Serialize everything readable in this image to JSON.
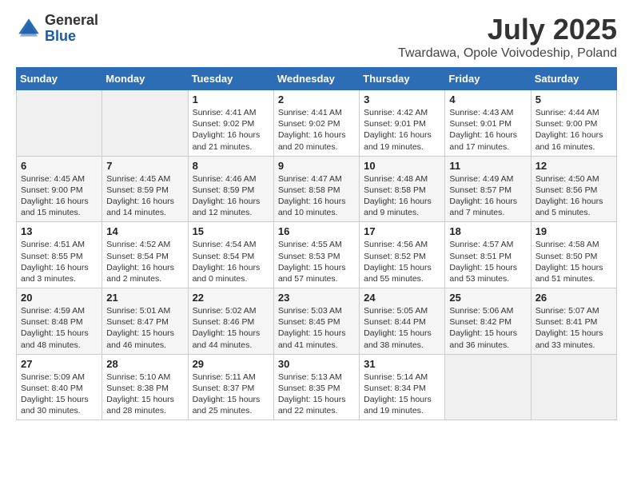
{
  "logo": {
    "general": "General",
    "blue": "Blue"
  },
  "header": {
    "title": "July 2025",
    "subtitle": "Twardawa, Opole Voivodeship, Poland"
  },
  "weekdays": [
    "Sunday",
    "Monday",
    "Tuesday",
    "Wednesday",
    "Thursday",
    "Friday",
    "Saturday"
  ],
  "weeks": [
    [
      {
        "day": "",
        "info": ""
      },
      {
        "day": "",
        "info": ""
      },
      {
        "day": "1",
        "info": "Sunrise: 4:41 AM\nSunset: 9:02 PM\nDaylight: 16 hours and 21 minutes."
      },
      {
        "day": "2",
        "info": "Sunrise: 4:41 AM\nSunset: 9:02 PM\nDaylight: 16 hours and 20 minutes."
      },
      {
        "day": "3",
        "info": "Sunrise: 4:42 AM\nSunset: 9:01 PM\nDaylight: 16 hours and 19 minutes."
      },
      {
        "day": "4",
        "info": "Sunrise: 4:43 AM\nSunset: 9:01 PM\nDaylight: 16 hours and 17 minutes."
      },
      {
        "day": "5",
        "info": "Sunrise: 4:44 AM\nSunset: 9:00 PM\nDaylight: 16 hours and 16 minutes."
      }
    ],
    [
      {
        "day": "6",
        "info": "Sunrise: 4:45 AM\nSunset: 9:00 PM\nDaylight: 16 hours and 15 minutes."
      },
      {
        "day": "7",
        "info": "Sunrise: 4:45 AM\nSunset: 8:59 PM\nDaylight: 16 hours and 14 minutes."
      },
      {
        "day": "8",
        "info": "Sunrise: 4:46 AM\nSunset: 8:59 PM\nDaylight: 16 hours and 12 minutes."
      },
      {
        "day": "9",
        "info": "Sunrise: 4:47 AM\nSunset: 8:58 PM\nDaylight: 16 hours and 10 minutes."
      },
      {
        "day": "10",
        "info": "Sunrise: 4:48 AM\nSunset: 8:58 PM\nDaylight: 16 hours and 9 minutes."
      },
      {
        "day": "11",
        "info": "Sunrise: 4:49 AM\nSunset: 8:57 PM\nDaylight: 16 hours and 7 minutes."
      },
      {
        "day": "12",
        "info": "Sunrise: 4:50 AM\nSunset: 8:56 PM\nDaylight: 16 hours and 5 minutes."
      }
    ],
    [
      {
        "day": "13",
        "info": "Sunrise: 4:51 AM\nSunset: 8:55 PM\nDaylight: 16 hours and 3 minutes."
      },
      {
        "day": "14",
        "info": "Sunrise: 4:52 AM\nSunset: 8:54 PM\nDaylight: 16 hours and 2 minutes."
      },
      {
        "day": "15",
        "info": "Sunrise: 4:54 AM\nSunset: 8:54 PM\nDaylight: 16 hours and 0 minutes."
      },
      {
        "day": "16",
        "info": "Sunrise: 4:55 AM\nSunset: 8:53 PM\nDaylight: 15 hours and 57 minutes."
      },
      {
        "day": "17",
        "info": "Sunrise: 4:56 AM\nSunset: 8:52 PM\nDaylight: 15 hours and 55 minutes."
      },
      {
        "day": "18",
        "info": "Sunrise: 4:57 AM\nSunset: 8:51 PM\nDaylight: 15 hours and 53 minutes."
      },
      {
        "day": "19",
        "info": "Sunrise: 4:58 AM\nSunset: 8:50 PM\nDaylight: 15 hours and 51 minutes."
      }
    ],
    [
      {
        "day": "20",
        "info": "Sunrise: 4:59 AM\nSunset: 8:48 PM\nDaylight: 15 hours and 48 minutes."
      },
      {
        "day": "21",
        "info": "Sunrise: 5:01 AM\nSunset: 8:47 PM\nDaylight: 15 hours and 46 minutes."
      },
      {
        "day": "22",
        "info": "Sunrise: 5:02 AM\nSunset: 8:46 PM\nDaylight: 15 hours and 44 minutes."
      },
      {
        "day": "23",
        "info": "Sunrise: 5:03 AM\nSunset: 8:45 PM\nDaylight: 15 hours and 41 minutes."
      },
      {
        "day": "24",
        "info": "Sunrise: 5:05 AM\nSunset: 8:44 PM\nDaylight: 15 hours and 38 minutes."
      },
      {
        "day": "25",
        "info": "Sunrise: 5:06 AM\nSunset: 8:42 PM\nDaylight: 15 hours and 36 minutes."
      },
      {
        "day": "26",
        "info": "Sunrise: 5:07 AM\nSunset: 8:41 PM\nDaylight: 15 hours and 33 minutes."
      }
    ],
    [
      {
        "day": "27",
        "info": "Sunrise: 5:09 AM\nSunset: 8:40 PM\nDaylight: 15 hours and 30 minutes."
      },
      {
        "day": "28",
        "info": "Sunrise: 5:10 AM\nSunset: 8:38 PM\nDaylight: 15 hours and 28 minutes."
      },
      {
        "day": "29",
        "info": "Sunrise: 5:11 AM\nSunset: 8:37 PM\nDaylight: 15 hours and 25 minutes."
      },
      {
        "day": "30",
        "info": "Sunrise: 5:13 AM\nSunset: 8:35 PM\nDaylight: 15 hours and 22 minutes."
      },
      {
        "day": "31",
        "info": "Sunrise: 5:14 AM\nSunset: 8:34 PM\nDaylight: 15 hours and 19 minutes."
      },
      {
        "day": "",
        "info": ""
      },
      {
        "day": "",
        "info": ""
      }
    ]
  ]
}
